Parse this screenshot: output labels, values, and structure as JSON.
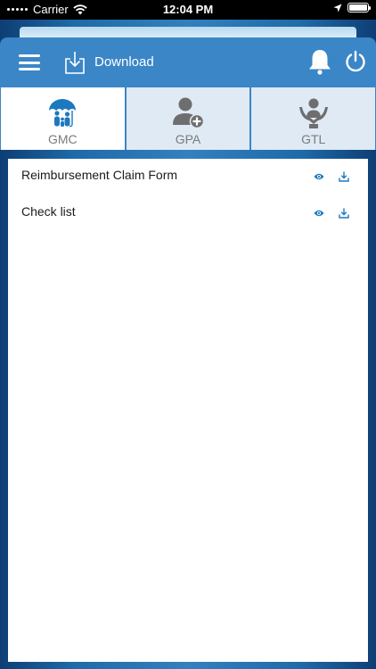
{
  "status_bar": {
    "carrier": "Carrier",
    "time": "12:04 PM"
  },
  "header": {
    "menu_icon": "hamburger-icon",
    "download_label": "Download",
    "notification_icon": "bell-icon",
    "logout_icon": "power-icon"
  },
  "tabs": [
    {
      "label": "GMC",
      "icon": "family-umbrella-icon",
      "active": true
    },
    {
      "label": "GPA",
      "icon": "user-add-icon",
      "active": false
    },
    {
      "label": "GTL",
      "icon": "person-hands-icon",
      "active": false
    }
  ],
  "documents": [
    {
      "label": "Reimbursement Claim Form",
      "view_icon": "eye-icon",
      "download_icon": "download-icon"
    },
    {
      "label": "Check list",
      "view_icon": "eye-icon",
      "download_icon": "download-icon"
    }
  ],
  "colors": {
    "header_blue": "#3b86c7",
    "icon_blue": "#1d79bf",
    "tab_inactive": "#dfeaf4",
    "icon_gray": "#6e6e6e"
  }
}
